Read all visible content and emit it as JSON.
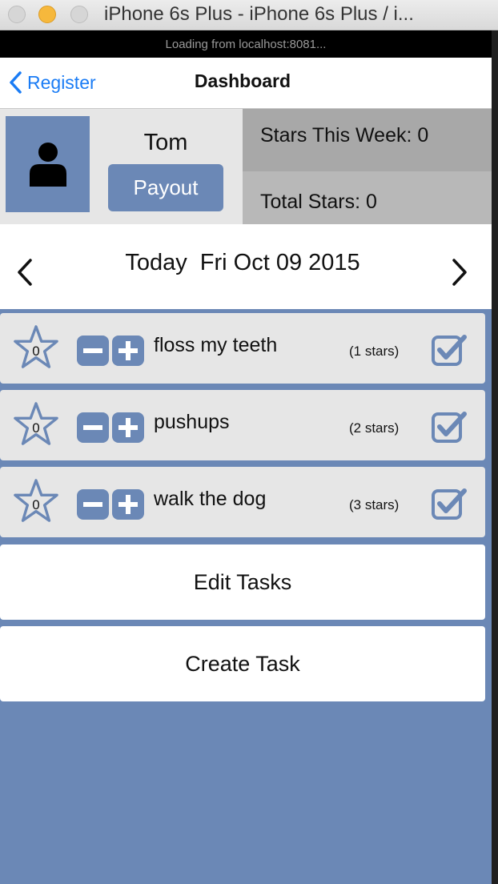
{
  "window": {
    "title": "iPhone 6s Plus - iPhone 6s Plus / i...",
    "loading_text": "Loading from localhost:8081..."
  },
  "nav": {
    "back_label": "Register",
    "title": "Dashboard"
  },
  "profile": {
    "name": "Tom",
    "payout_label": "Payout",
    "stars_this_week": "Stars This Week: 0",
    "total_stars": "Total Stars: 0"
  },
  "date": {
    "text": "Today  Fri Oct 09 2015"
  },
  "tasks": [
    {
      "count": "0",
      "name": "floss my teeth",
      "stars": "(1 stars)"
    },
    {
      "count": "0",
      "name": "pushups",
      "stars": "(2 stars)"
    },
    {
      "count": "0",
      "name": "walk the dog",
      "stars": "(3 stars)"
    }
  ],
  "actions": {
    "edit_tasks": "Edit Tasks",
    "create_task": "Create Task"
  },
  "colors": {
    "accent": "#6b88b6",
    "link": "#1a7cf5",
    "panel": "#e6e6e6"
  },
  "icons": [
    "chevron-left-icon",
    "person-icon",
    "star-icon",
    "minus-icon",
    "plus-icon",
    "checkbox-icon",
    "chevron-right-icon"
  ]
}
